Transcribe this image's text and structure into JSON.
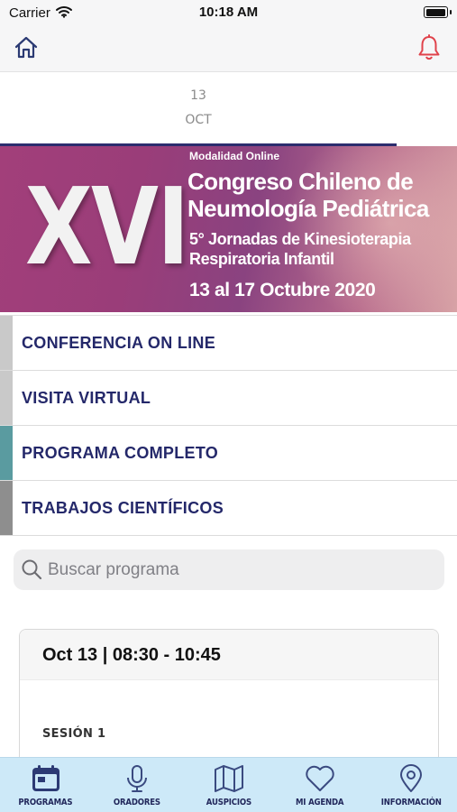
{
  "status_bar": {
    "carrier": "Carrier",
    "time": "10:18 AM"
  },
  "date_strip": {
    "day": "13",
    "month": "OCT"
  },
  "banner": {
    "line1": "Modalidad Online",
    "roman": "XVI",
    "line2": "Congreso Chileno de",
    "line3": "Neumología Pediátrica",
    "line4": "5° Jornadas de Kinesioterapia",
    "line5": "Respiratoria Infantil",
    "line6": "13 al 17 Octubre 2020"
  },
  "menu": {
    "items": [
      {
        "label": "CONFERENCIA ON LINE",
        "accent": "#c9c9c9"
      },
      {
        "label": "VISITA VIRTUAL",
        "accent": "#c9c9c9"
      },
      {
        "label": "PROGRAMA COMPLETO",
        "accent": "#5a9ba0"
      },
      {
        "label": "TRABAJOS CIENTÍFICOS",
        "accent": "#8e8e8e"
      }
    ]
  },
  "search": {
    "placeholder": "Buscar programa"
  },
  "session_card": {
    "when": "Oct 13 | 08:30 - 10:45",
    "session": "SESIÓN 1"
  },
  "tab_bar": {
    "tabs": [
      {
        "label": "PROGRAMAS",
        "icon": "calendar-icon"
      },
      {
        "label": "ORADORES",
        "icon": "microphone-icon"
      },
      {
        "label": "AUSPICIOS",
        "icon": "map-icon"
      },
      {
        "label": "MI AGENDA",
        "icon": "heart-icon"
      },
      {
        "label": "INFORMACIÓN",
        "icon": "location-pin-icon"
      }
    ]
  },
  "colors": {
    "brand_navy": "#24286a",
    "bell_red": "#e0424b",
    "tab_bar_bg": "#cde9f8"
  }
}
